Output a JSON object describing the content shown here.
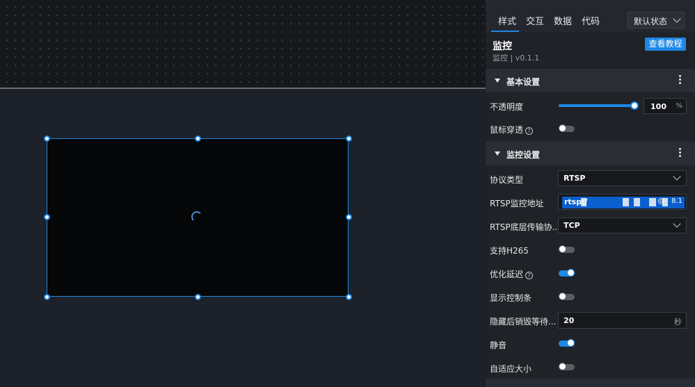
{
  "tabs": [
    {
      "label": "样式",
      "active": true
    },
    {
      "label": "交互",
      "active": false
    },
    {
      "label": "数据",
      "active": false
    },
    {
      "label": "代码",
      "active": false
    }
  ],
  "state_select": {
    "value": "默认状态"
  },
  "component": {
    "title": "监控",
    "version": "监控 | v0.1.1",
    "tutorial_button": "查看教程"
  },
  "sections": {
    "basic": {
      "title": "基本设置"
    },
    "monitor": {
      "title": "监控设置"
    }
  },
  "basic": {
    "opacity": {
      "label": "不透明度",
      "value": "100",
      "unit": "%",
      "level": 1.0
    },
    "mouse_through": {
      "label": "鼠标穿透",
      "help": "?",
      "on": false
    }
  },
  "monitor": {
    "protocol": {
      "label": "协议类型",
      "value": "RTSP"
    },
    "rtsp_url": {
      "label": "RTSP监控地址",
      "value": "rtsp:/",
      "tail_at": "@",
      "tail": "8.1"
    },
    "transport": {
      "label": "RTSP底层传输协...",
      "value": "TCP"
    },
    "h265": {
      "label": "支持H265",
      "on": false
    },
    "optimize_delay": {
      "label": "优化延迟",
      "help": "?",
      "on": true
    },
    "show_controls": {
      "label": "显示控制条",
      "on": false
    },
    "destroy_wait": {
      "label": "隐藏后销毁等待...",
      "value": "20",
      "unit": "秒"
    },
    "mute": {
      "label": "静音",
      "on": true
    },
    "auto_size": {
      "label": "自适应大小",
      "on": false
    }
  },
  "colors": {
    "accent": "#1e88e5",
    "panel_bg": "#1f2227",
    "section_bg": "#2a2d33",
    "canvas_bg": "#1d2129"
  }
}
